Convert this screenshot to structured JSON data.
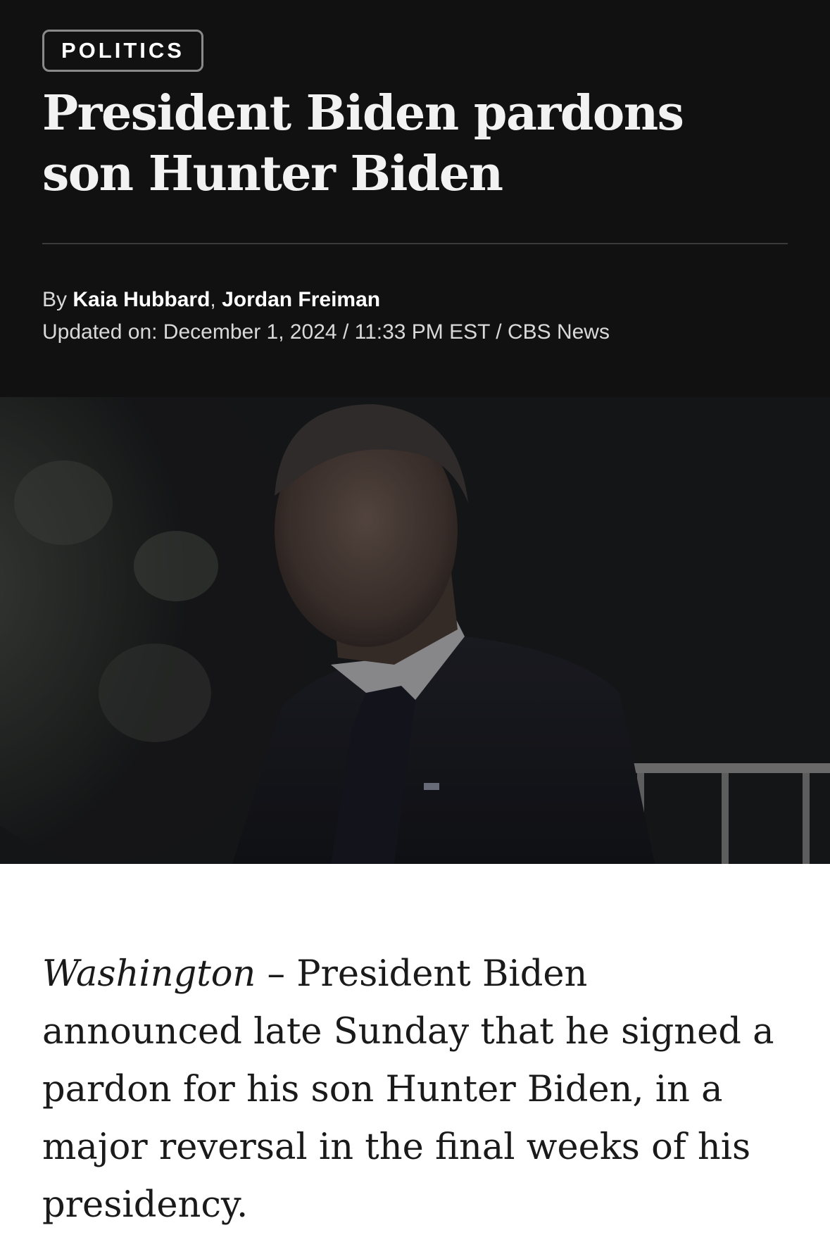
{
  "header": {
    "category": "POLITICS",
    "headline": "President Biden pardons son Hunter Biden",
    "byline_prefix": "By ",
    "authors": [
      "Kaia Hubbard",
      "Jordan Freiman"
    ],
    "author_separator": ", ",
    "updated_line": "Updated on: December 1, 2024 / 11:33 PM EST / CBS News"
  },
  "hero_image": {
    "description_icon": "photo-hunter-biden"
  },
  "article": {
    "dateline": "Washington",
    "dash": " – ",
    "lead": "President Biden announced late Sunday that he signed a pardon for his son Hunter Biden, in a major reversal in the final weeks of his presidency."
  },
  "colors": {
    "header_bg": "#111111",
    "page_bg": "#ffffff",
    "headline": "#f2f2f2",
    "body_text": "#1a1a1a"
  }
}
